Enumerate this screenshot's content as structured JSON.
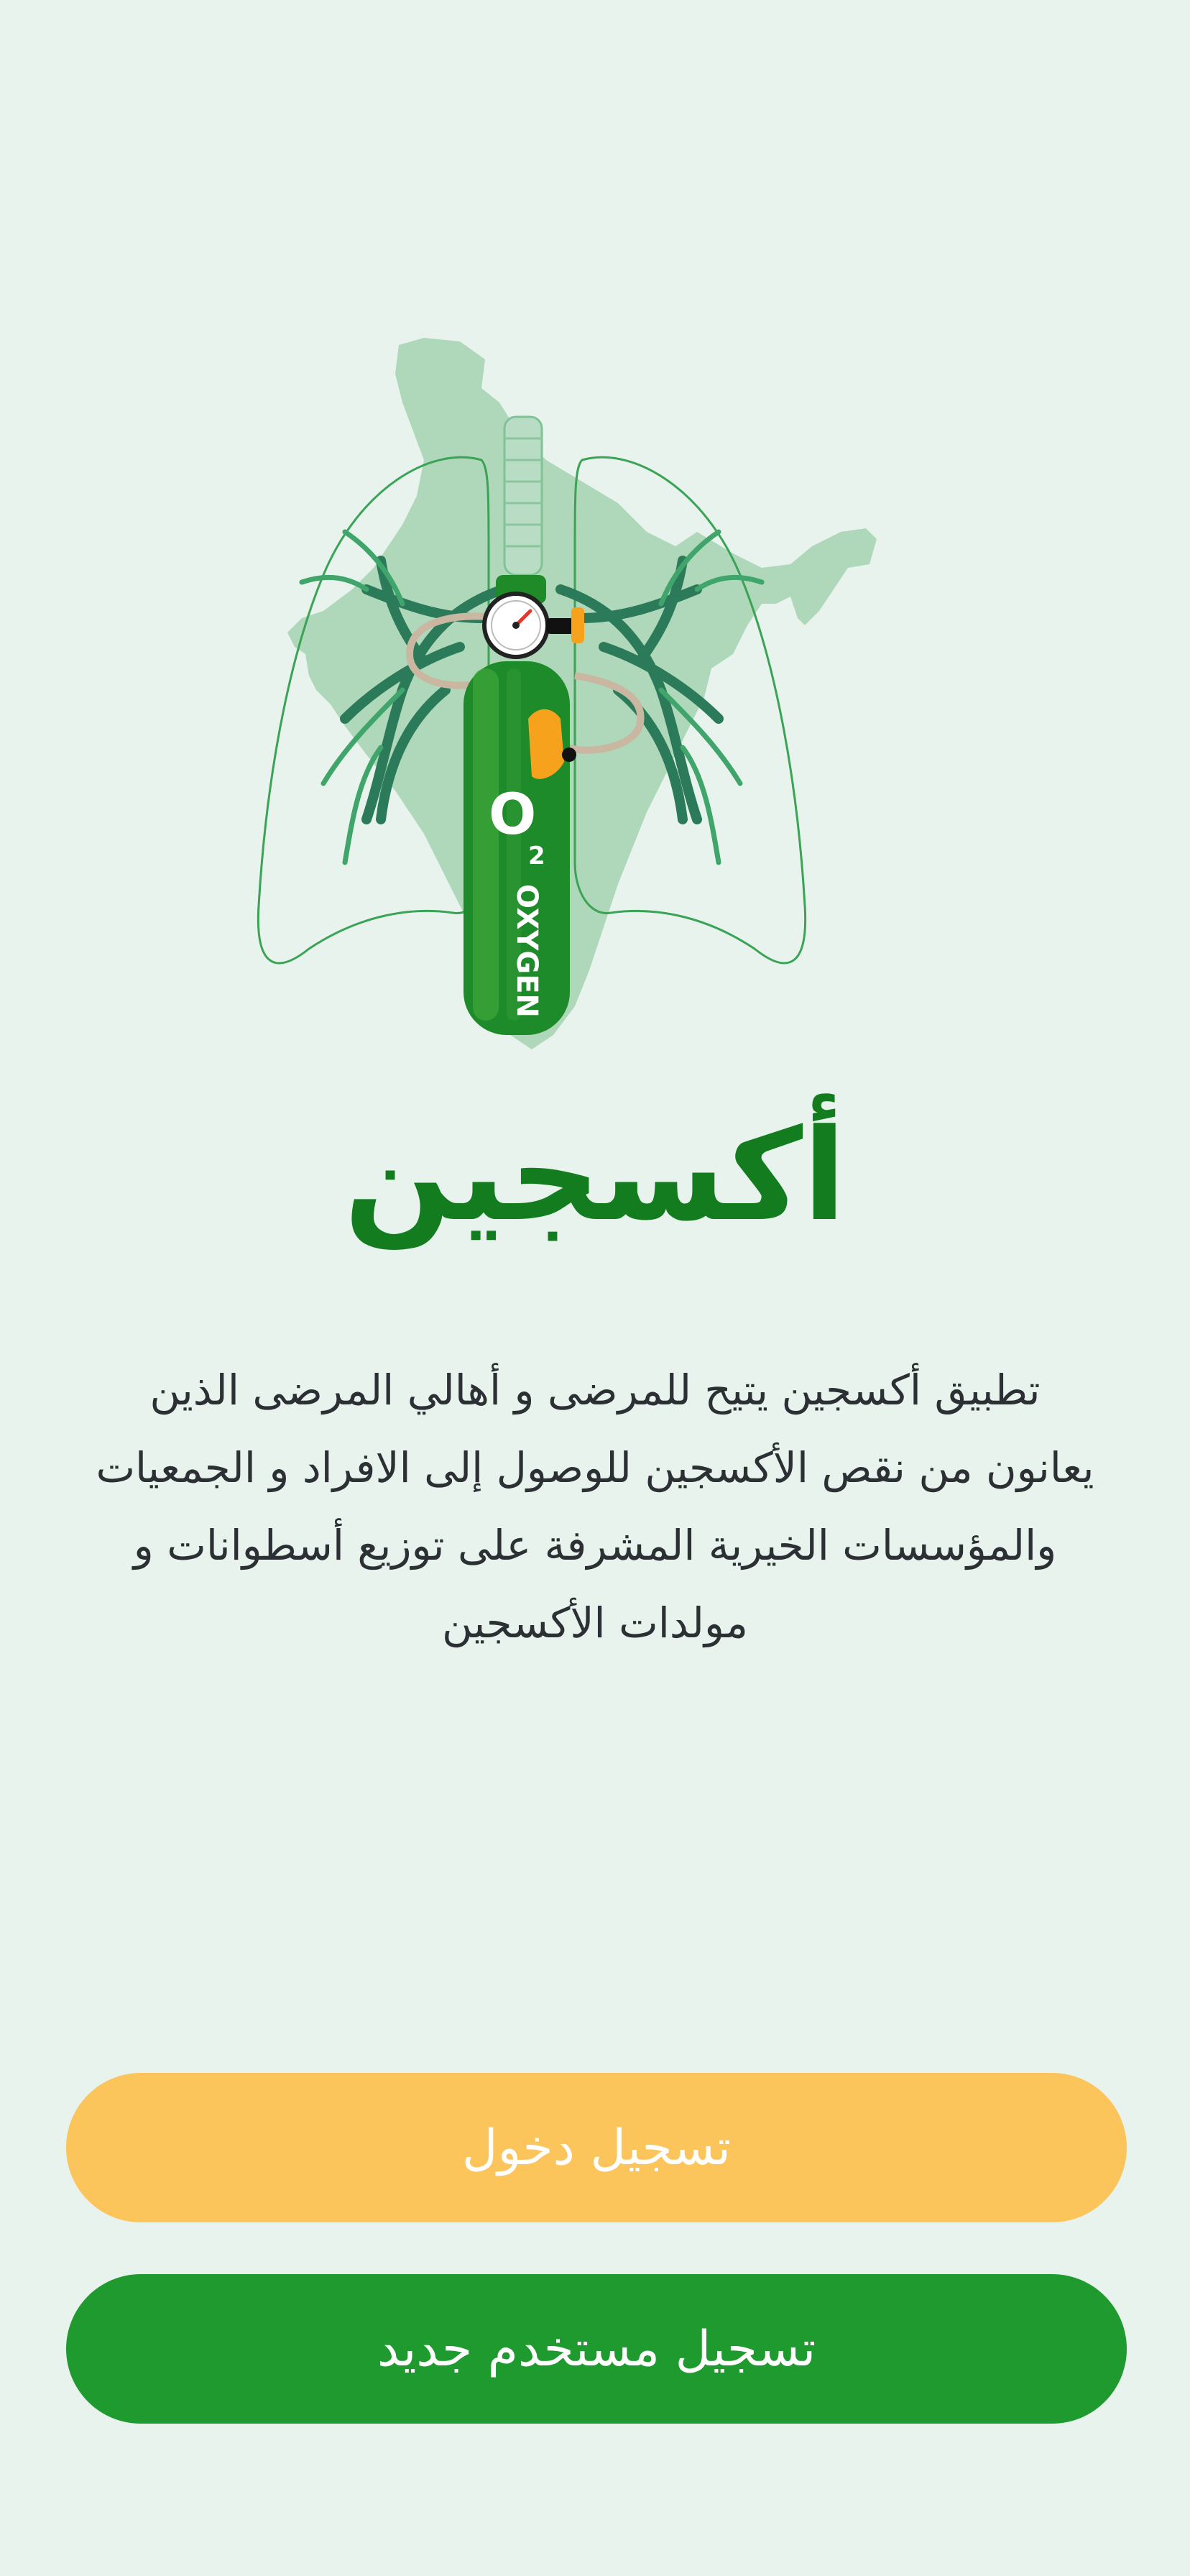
{
  "app": {
    "title": "أكسجين",
    "description": "تطبيق أكسجين يتيح للمرضى و أهالي المرضى الذين يعانون من نقص الأكسجين للوصول إلى الافراد و الجمعيات والمؤسسات الخيرية المشرفة على توزيع أسطوانات و مولدات الأكسجين"
  },
  "illustration": {
    "icon_names": [
      "map-silhouette-icon",
      "lungs-icon",
      "oxygen-cylinder-icon",
      "pressure-gauge-icon"
    ],
    "cylinder_symbol": "O",
    "cylinder_subscript": "2",
    "cylinder_label": "OXYGEN"
  },
  "buttons": {
    "login_label": "تسجيل دخول",
    "register_label": "تسجيل مستخدم جديد"
  },
  "colors": {
    "background": "#e7f3ec",
    "title": "#137c1f",
    "login_button": "#fbc55b",
    "register_button": "#1f9a2e",
    "text": "#2c2f33"
  }
}
